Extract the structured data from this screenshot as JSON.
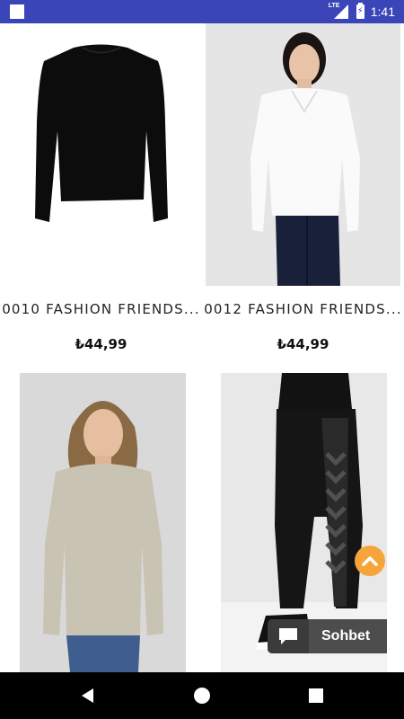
{
  "status_bar": {
    "network": "LTE",
    "time": "1:41"
  },
  "products": [
    {
      "name": "0010 FASHION FRIENDS...",
      "price": "₺44,99",
      "image": "black-long-sleeve-top"
    },
    {
      "name": "0012 FASHION FRIENDS...",
      "price": "₺44,99",
      "image": "white-v-neck-sweater-model"
    },
    {
      "name": "",
      "price": "",
      "image": "beige-knit-sweater-model"
    },
    {
      "name": "",
      "price": "",
      "image": "black-leggings-chevron"
    }
  ],
  "chat": {
    "label": "Sohbet"
  },
  "colors": {
    "status_bar": "#3a46b8",
    "scroll_top": "#f5a53a",
    "chat_bg": "#4d4d4d"
  }
}
